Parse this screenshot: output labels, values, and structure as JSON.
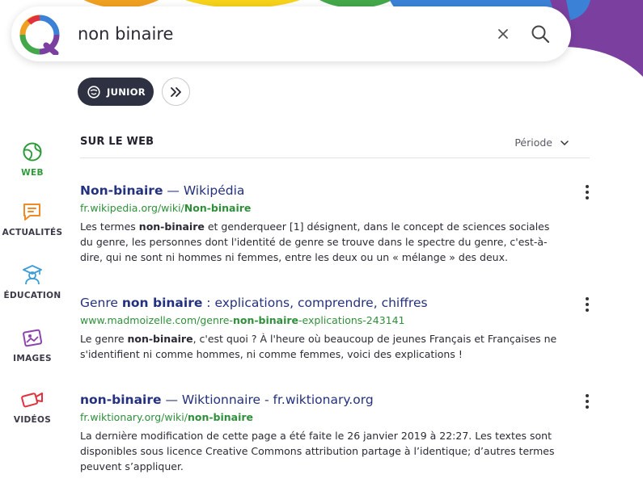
{
  "search": {
    "query": "non binaire"
  },
  "toolbar": {
    "junior_label": "JUNIOR"
  },
  "nav": {
    "items": [
      {
        "label": "WEB",
        "icon": "globe-icon",
        "color": "#2e9b3a",
        "active": true
      },
      {
        "label": "ACTUALITÉS",
        "icon": "news-icon",
        "color": "#f08a24"
      },
      {
        "label": "ÉDUCATION",
        "icon": "graduation-cap-icon",
        "color": "#3b9dd8"
      },
      {
        "label": "IMAGES",
        "icon": "image-icon",
        "color": "#8e44ad"
      },
      {
        "label": "VIDÉOS",
        "icon": "video-icon",
        "color": "#e0313d"
      }
    ]
  },
  "results_header": {
    "title": "SUR LE WEB",
    "period_label": "Période"
  },
  "results": [
    {
      "title_parts": [
        "Non-binaire",
        " — Wikipédia"
      ],
      "url_parts": [
        "fr.wikipedia.org/wiki/",
        "Non-binaire"
      ],
      "snippet_parts": [
        "Les termes ",
        "non-binaire",
        " et genderqueer [1] désignent, dans le concept de sciences sociales du genre, les personnes dont l'identité de genre se trouve dans le spectre du genre, c'est-à-dire, qui ne sont ni hommes ni femmes, entre les deux ou un « mélange » des deux."
      ]
    },
    {
      "title_parts": [
        "Genre ",
        "non binaire",
        " : explications, comprendre, chiffres"
      ],
      "url_parts": [
        "www.madmoizelle.com/genre-",
        "non-binaire",
        "-explications-243141"
      ],
      "snippet_parts": [
        "Le genre ",
        "non-binaire",
        ", c'est quoi ? À l'heure où beaucoup de jeunes Français et Françaises ne s'identifient ni comme hommes, ni comme femmes, voici des explications !"
      ]
    },
    {
      "title_parts": [
        "non-binaire",
        " — Wiktionnaire - fr.wiktionary.org"
      ],
      "url_parts": [
        "fr.wiktionary.org/wiki/",
        "non-binaire"
      ],
      "snippet_parts": [
        "La dernière modification de cette page a été faite le 26 janvier 2019 à 22:27. Les textes sont disponibles sous licence Creative Commons attribution partage à l’identique; d’autres termes peuvent s’appliquer."
      ]
    }
  ],
  "colors": {
    "title_link": "#24317e",
    "url_green": "#2f8f3a",
    "junior_bg": "#2d3142"
  }
}
